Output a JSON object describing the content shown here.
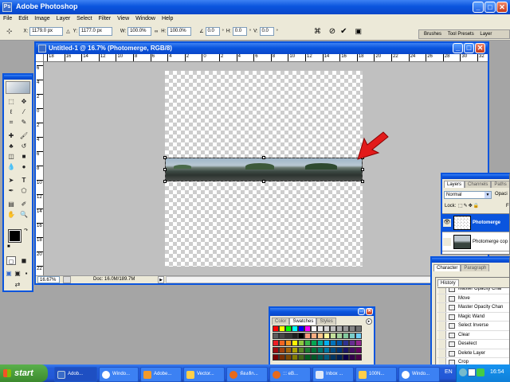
{
  "app": {
    "title": "Adobe Photoshop"
  },
  "menu": [
    "File",
    "Edit",
    "Image",
    "Layer",
    "Select",
    "Filter",
    "View",
    "Window",
    "Help"
  ],
  "options": {
    "x_label": "X:",
    "x_value": "1179.0 px",
    "y_label": "Y:",
    "y_value": "1177.0 px",
    "w_label": "W:",
    "w_value": "100.0%",
    "h_label": "H:",
    "h_value": "100.0%",
    "angle_value": "0.0",
    "hskew_label": "H:",
    "hskew_value": "0.0",
    "vskew_label": "V:",
    "vskew_value": "0.0",
    "wells": [
      "Brushes",
      "Tool Presets",
      "Layer"
    ]
  },
  "document": {
    "title": "Untitled-1 @ 16.7% (Photomerge, RGB/8)",
    "ruler_top": [
      "18",
      "16",
      "14",
      "12",
      "10",
      "8",
      "6",
      "4",
      "2",
      "0",
      "2",
      "4",
      "6",
      "8",
      "10",
      "12",
      "14",
      "16",
      "18",
      "20",
      "22",
      "24",
      "26",
      "28",
      "30",
      "32"
    ],
    "ruler_left": [
      "6",
      "4",
      "2",
      "0",
      "2",
      "4",
      "6",
      "8",
      "10",
      "12",
      "14",
      "16",
      "18",
      "20",
      "22"
    ],
    "zoom": "16.67%",
    "doc_size": "Doc: 16.0M/189.7M"
  },
  "layers": {
    "tabs": [
      "Layers",
      "Channels",
      "Paths"
    ],
    "blend_mode": "Normal",
    "opacity_label": "Opaci",
    "lock_label": "Lock:",
    "fill_label": "F",
    "items": [
      {
        "name": "Photomerge"
      },
      {
        "name": "Photomerge cop"
      }
    ]
  },
  "character": {
    "tabs": [
      "Character",
      "Paragraph"
    ]
  },
  "history": {
    "tab": "History",
    "items": [
      "Master Opacity Char",
      "Move",
      "Master Opacity Chan",
      "Magic Wand",
      "Select Inverse",
      "Clear",
      "Deselect",
      "Delete Layer",
      "Crop"
    ]
  },
  "swatches": {
    "tabs": [
      "Color",
      "Swatches",
      "Styles"
    ]
  },
  "taskbar": {
    "start": "start",
    "items": [
      "Adob...",
      "Windo...",
      "Adobe...",
      "Vector...",
      "ห้องลัก...",
      "::: eB...",
      "Inbox ...",
      "100N...",
      "Windo..."
    ],
    "lang": "EN",
    "clock": "16:54"
  },
  "colors": {
    "xp_blue": "#0a55de",
    "canvas_gray": "#a5a5a5",
    "panel_bg": "#ece9d8",
    "arrow_red": "#e21b1b"
  }
}
